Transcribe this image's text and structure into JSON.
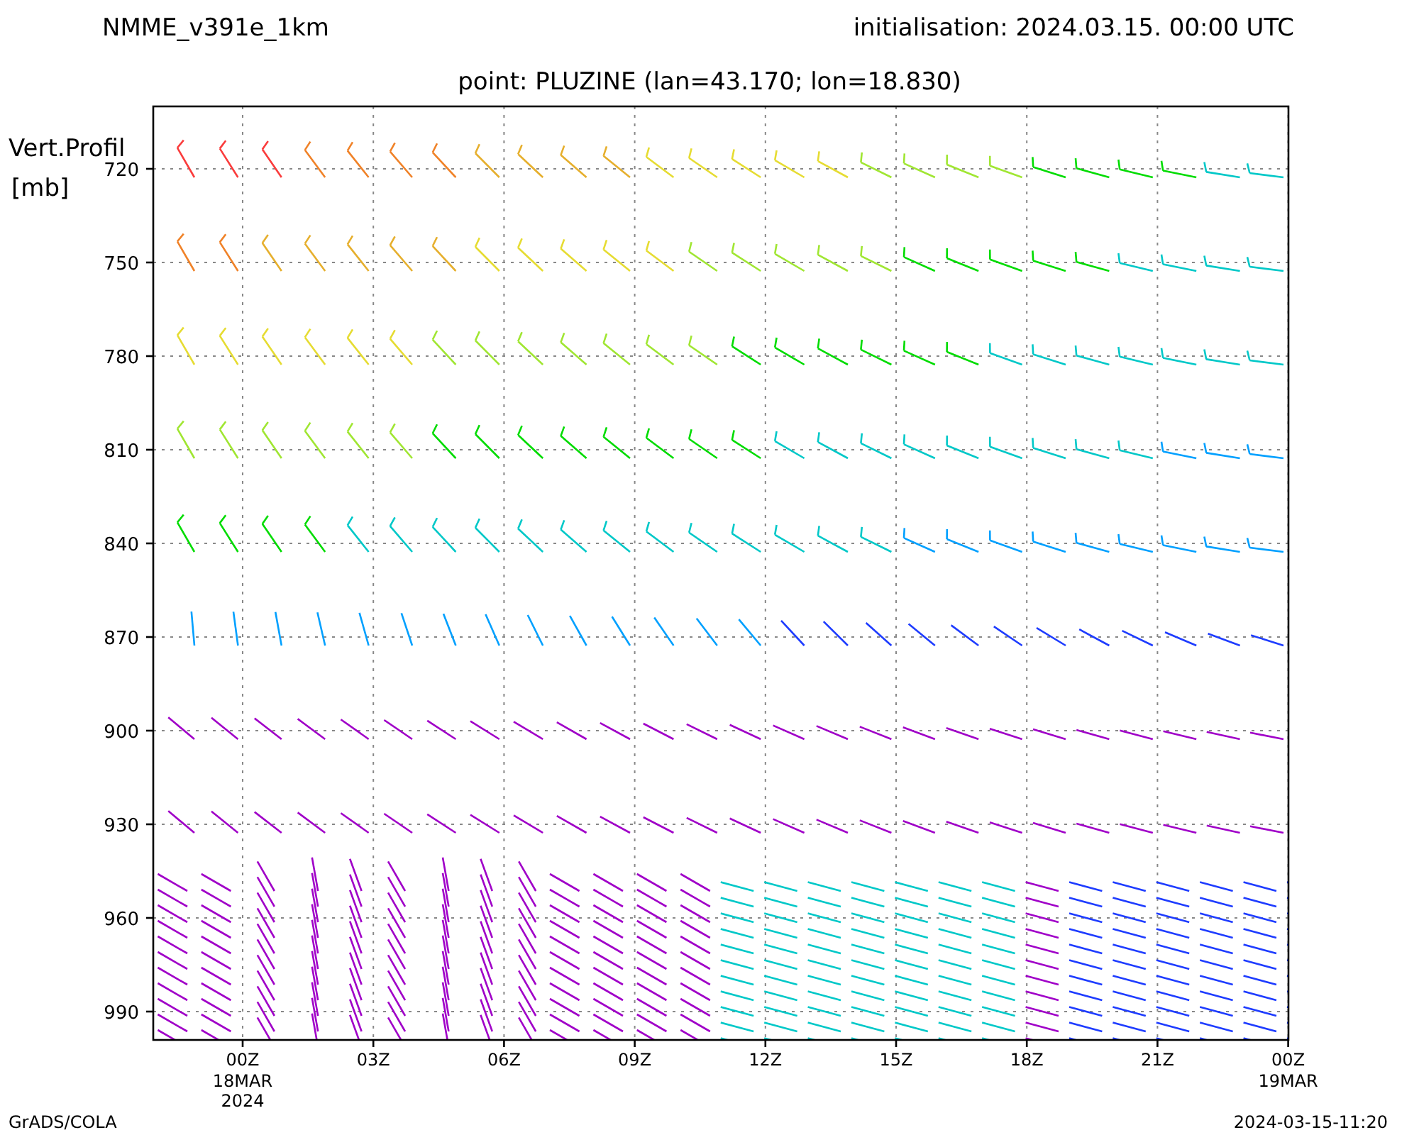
{
  "header": {
    "model": "NMME_v391e_1km",
    "initialisation": "initialisation: 2024.03.15. 00:00 UTC",
    "point": "point: PLUZINE (lan=43.170; lon=18.830)"
  },
  "chart": {
    "ylabel_lines": [
      "Vert.Profil",
      "[mb]"
    ],
    "yticks": [
      "720",
      "750",
      "780",
      "810",
      "840",
      "870",
      "900",
      "930",
      "960",
      "990"
    ],
    "xticks": [
      {
        "label": "00Z",
        "sub": [
          "18MAR",
          "2024"
        ]
      },
      {
        "label": "03Z"
      },
      {
        "label": "06Z"
      },
      {
        "label": "09Z"
      },
      {
        "label": "12Z"
      },
      {
        "label": "15Z"
      },
      {
        "label": "18Z"
      },
      {
        "label": "21Z"
      },
      {
        "label": "00Z",
        "sub": [
          "19MAR"
        ]
      }
    ]
  },
  "footer": {
    "left": "GrADS/COLA",
    "right": "2024-03-15-11:20"
  }
}
